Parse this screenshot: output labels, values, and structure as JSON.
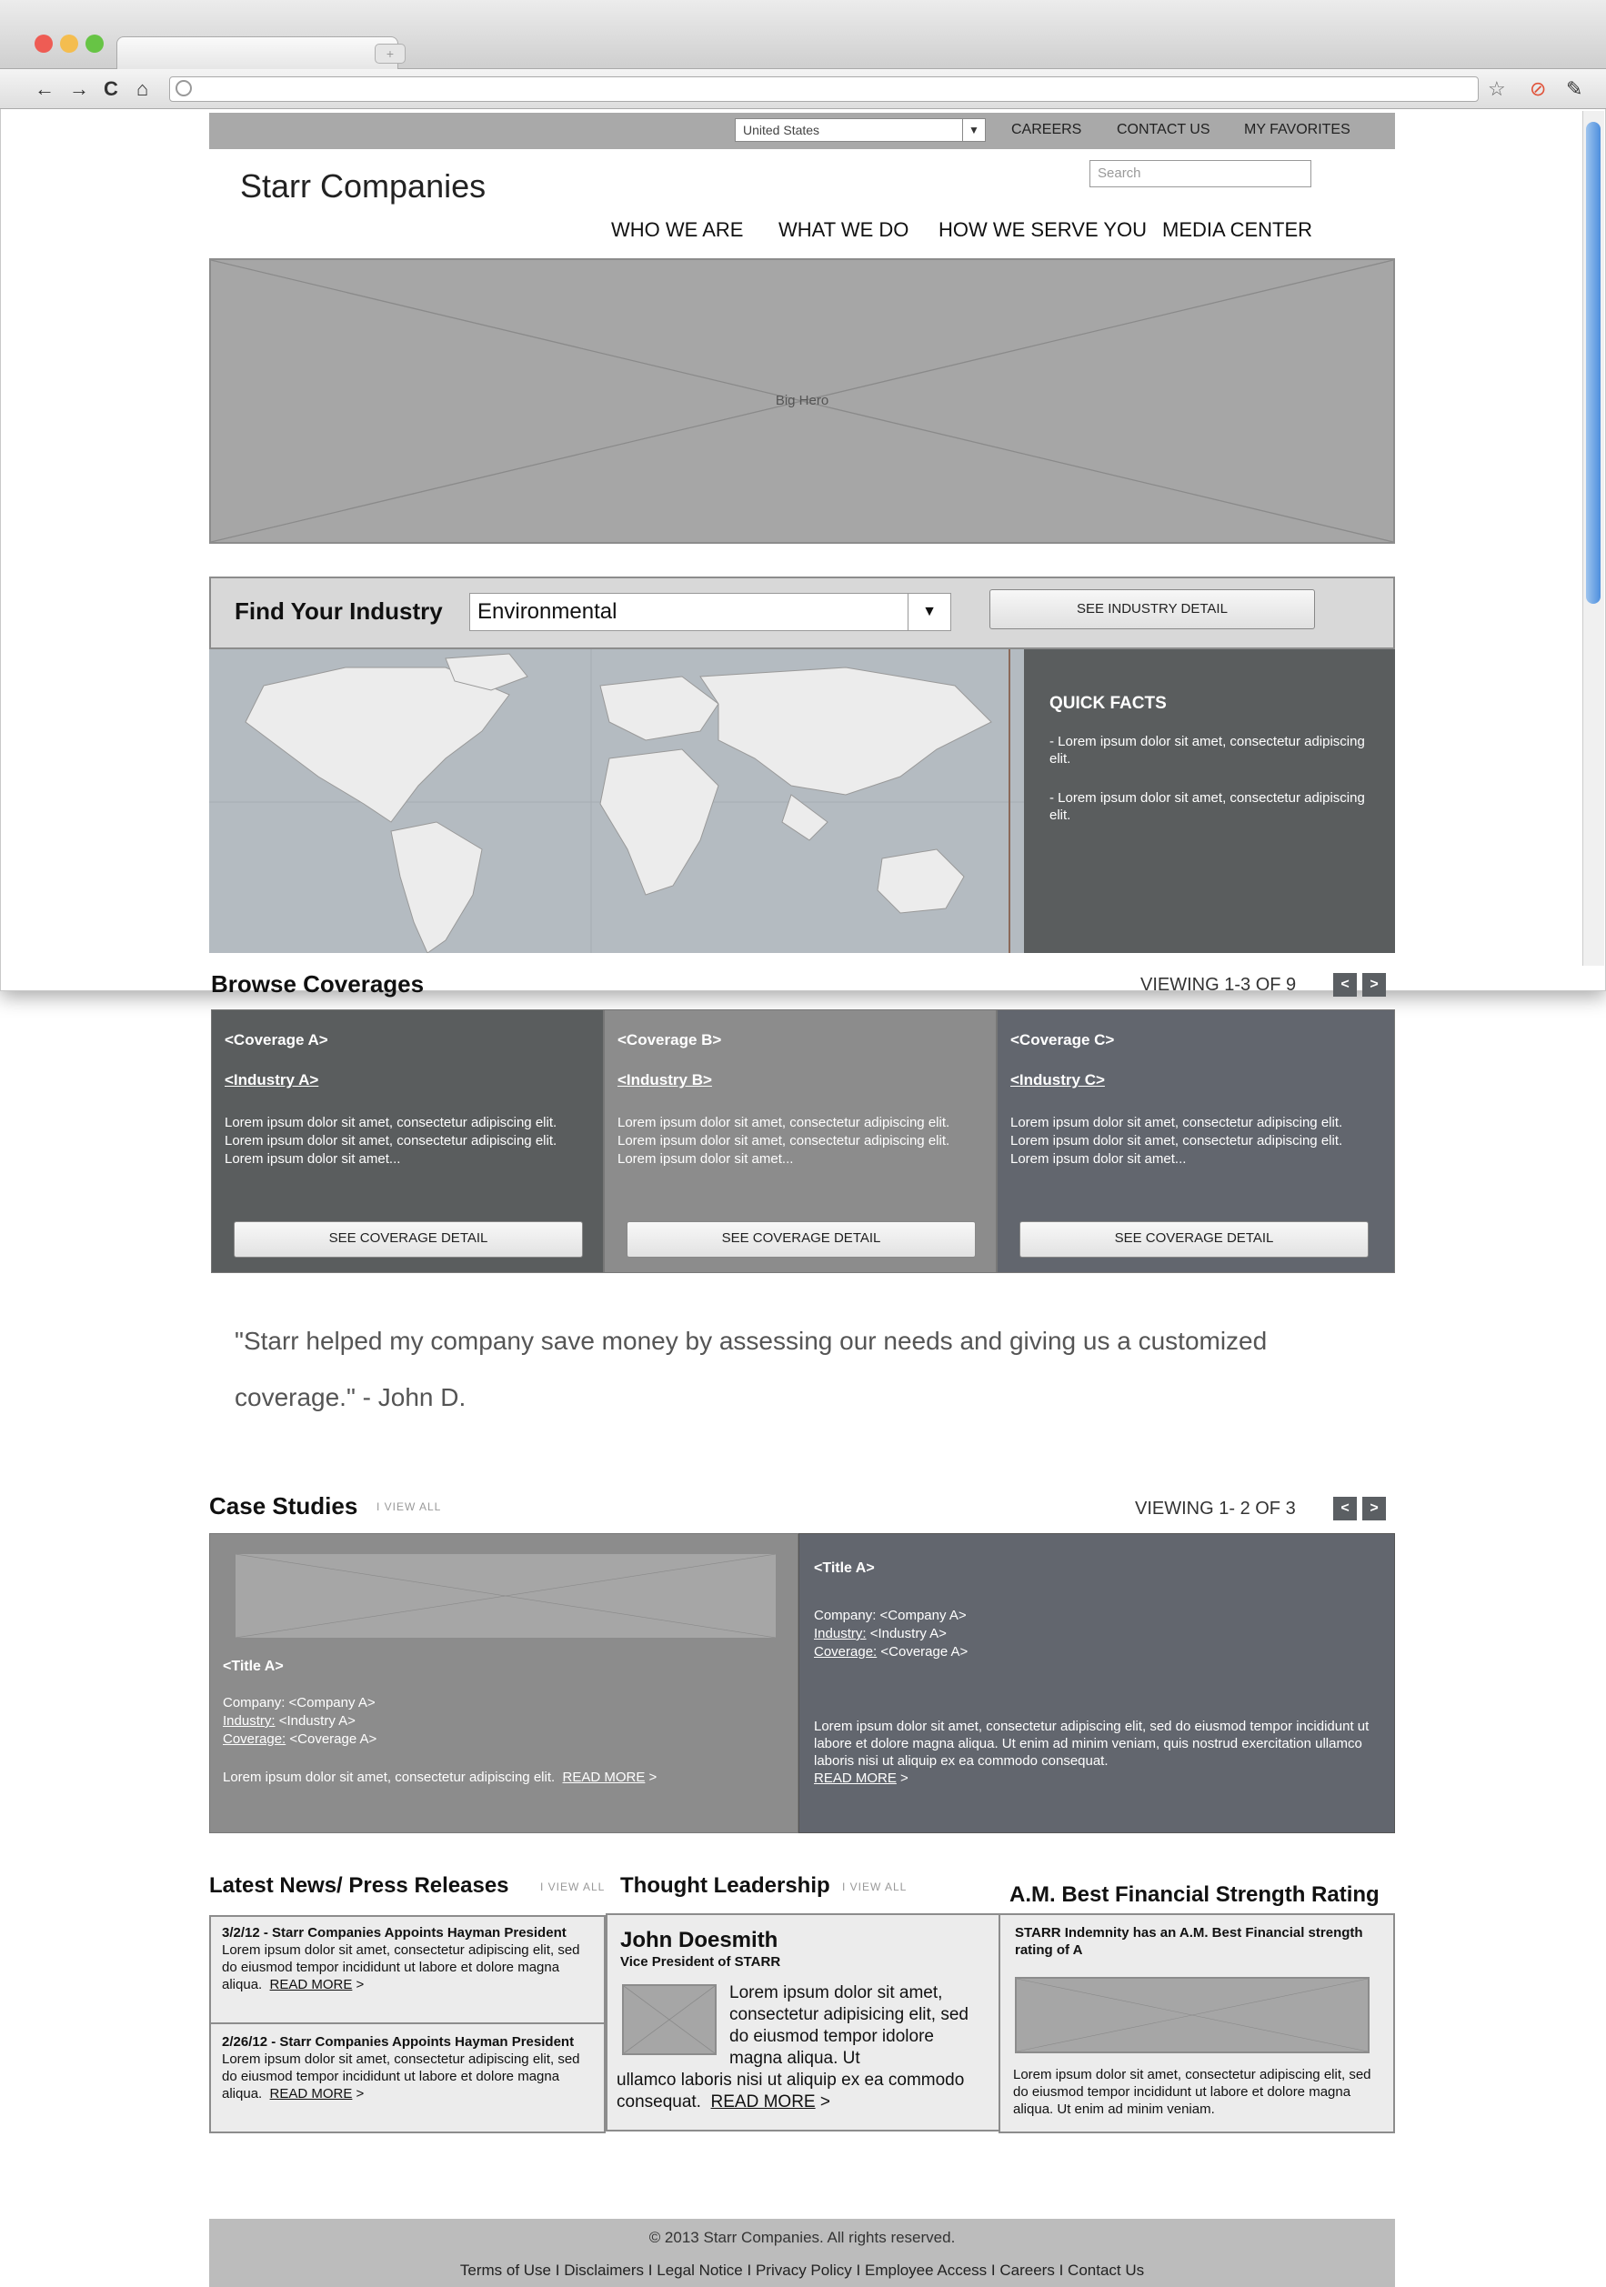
{
  "browser": {
    "tab_close": "×",
    "new_tab": "+",
    "nav": {
      "back": "←",
      "forward": "→",
      "reload": "C",
      "home": "⌂"
    },
    "toolbar_icons": {
      "star": "☆",
      "stop": "⊘",
      "wrench": "✎"
    }
  },
  "utility_bar": {
    "country": "United States",
    "links": [
      "CAREERS",
      "CONTACT US",
      "MY FAVORITES"
    ]
  },
  "header": {
    "logo": "Starr Companies",
    "search_placeholder": "Search",
    "nav": [
      "WHO WE ARE",
      "WHAT WE DO",
      "HOW WE SERVE YOU",
      "MEDIA CENTER"
    ]
  },
  "hero": {
    "label": "Big Hero"
  },
  "industry": {
    "label": "Find Your Industry",
    "selected": "Environmental",
    "button": "SEE INDUSTRY DETAIL"
  },
  "quick_facts": {
    "title": "QUICK FACTS",
    "facts": [
      "- Lorem ipsum dolor sit amet, consectetur adipiscing elit.",
      "- Lorem ipsum dolor sit amet, consectetur adipiscing elit."
    ]
  },
  "coverages": {
    "title": "Browse Coverages",
    "pager": "VIEWING 1-3 OF 9",
    "prev": "<",
    "next": ">",
    "cards": [
      {
        "title": "<Coverage A>",
        "industry": "<Industry A>",
        "text": "Lorem ipsum dolor sit amet, consectetur adipiscing elit. Lorem ipsum dolor sit amet, consectetur adipiscing elit.",
        "text2": "Lorem ipsum dolor sit amet...",
        "button": "SEE COVERAGE DETAIL",
        "color": "#5a5d5e"
      },
      {
        "title": "<Coverage B>",
        "industry": "<Industry B>",
        "text": "Lorem ipsum dolor sit amet, consectetur adipiscing elit. Lorem ipsum dolor sit amet, consectetur adipiscing elit.",
        "text2": "Lorem ipsum dolor sit amet...",
        "button": "SEE COVERAGE DETAIL",
        "color": "#8c8c8c"
      },
      {
        "title": "<Coverage C>",
        "industry": "<Industry C>",
        "text": "Lorem ipsum dolor sit amet, consectetur adipiscing elit. Lorem ipsum dolor sit amet, consectetur adipiscing elit.",
        "text2": "Lorem ipsum dolor sit amet...",
        "button": "SEE COVERAGE DETAIL",
        "color": "#62666e"
      }
    ]
  },
  "testimonial": {
    "quote": "\"Starr helped my company save money by assessing our needs and giving us a customized coverage.\" - John D."
  },
  "case_studies": {
    "title": "Case Studies",
    "view_all": "I VIEW ALL",
    "pager": "VIEWING 1- 2 OF 3",
    "prev": "<",
    "next": ">",
    "left": {
      "title": "<Title A>",
      "company": "Company: <Company A>",
      "industry_label": "Industry:",
      "industry_value": " <Industry A>",
      "coverage_label": "Coverage:",
      "coverage_value": " <Coverage A>",
      "text": "Lorem ipsum dolor sit amet, consectetur adipiscing elit.",
      "read_more": "READ MORE",
      "arrow": " >"
    },
    "right": {
      "title": "<Title A>",
      "company": "Company: <Company A>",
      "industry_label": "Industry:",
      "industry_value": " <Industry A>",
      "coverage_label": "Coverage:",
      "coverage_value": " <Coverage A>",
      "text": "Lorem ipsum dolor sit amet, consectetur adipiscing elit, sed do eiusmod tempor incididunt ut labore et dolore magna aliqua. Ut enim ad minim veniam, quis nostrud exercitation ullamco laboris nisi ut aliquip ex ea commodo consequat.",
      "read_more": "READ MORE",
      "arrow": " >"
    }
  },
  "news": {
    "title": "Latest News/ Press Releases",
    "view_all": "I VIEW ALL",
    "items": [
      {
        "headline": "3/2/12 - Starr Companies Appoints Hayman President",
        "text": "Lorem ipsum dolor sit amet, consectetur adipiscing elit, sed do eiusmod tempor incididunt ut labore et dolore magna aliqua.",
        "read_more": "READ MORE",
        "arrow": " >"
      },
      {
        "headline": "2/26/12 - Starr Companies Appoints Hayman President",
        "text": "Lorem ipsum dolor sit amet, consectetur adipiscing elit, sed do eiusmod tempor incididunt ut labore et dolore magna aliqua.",
        "read_more": "READ MORE",
        "arrow": " >"
      }
    ]
  },
  "thought": {
    "title": "Thought Leadership",
    "view_all": "I VIEW ALL",
    "name": "John Doesmith",
    "role": "Vice President of STARR",
    "text_a": "Lorem ipsum dolor sit amet, consectetur adipisicing elit, sed do eiusmod tempor idolore magna aliqua. Ut",
    "text_b": "ullamco laboris nisi ut aliquip ex ea commodo consequat.",
    "read_more": "READ MORE",
    "arrow": " >"
  },
  "rating": {
    "title": "A.M. Best Financial Strength Rating",
    "headline": "STARR Indemnity has an A.M. Best Financial strength rating of A",
    "text": "Lorem ipsum dolor sit amet, consectetur adipiscing elit, sed do eiusmod tempor incididunt ut labore et dolore magna aliqua. Ut enim ad minim veniam."
  },
  "footer": {
    "copyright": "© 2013 Starr Companies. All rights reserved.",
    "links": [
      "Terms of Use",
      "Disclaimers",
      "Legal Notice",
      "Privacy Policy",
      "Employee Access",
      "Careers",
      "Contact Us"
    ],
    "separator": "I"
  }
}
